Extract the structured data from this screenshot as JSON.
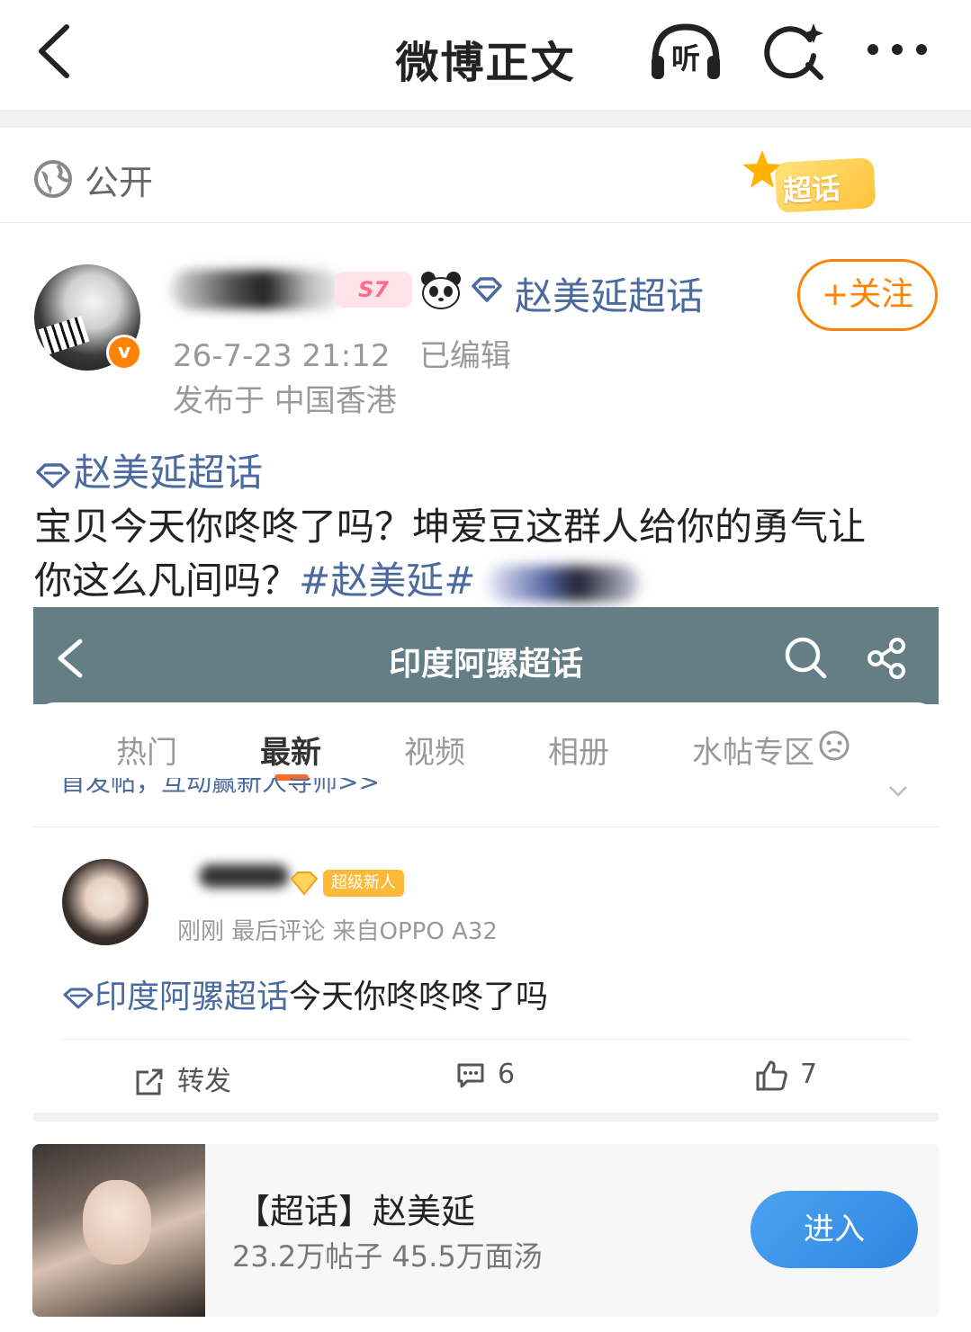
{
  "header": {
    "title": "微博正文",
    "listen_label": "听"
  },
  "visibility": {
    "label": "公开",
    "badge_label": "超话"
  },
  "post": {
    "author_level_badge": "S7",
    "author_topic": "赵美延超话",
    "follow_label": "+关注",
    "verified_badge": "v",
    "timestamp": "26-7-23 21:12",
    "edited_label": "已编辑",
    "location": "发布于 中国香港",
    "topic_link": "赵美延超话",
    "text_line1": "宝贝今天你咚咚了吗？坤爱豆这群人给你的勇气让",
    "text_line2_prefix": "你这么凡间吗？",
    "hashtag": "#赵美延#"
  },
  "embedded": {
    "title": "印度阿骡超话",
    "tabs": [
      "热门",
      "最新",
      "视频",
      "相册",
      "水帖专区"
    ],
    "active_tab": "最新",
    "partial_line": "首发帖，互动赢新人导师>>",
    "user_badge": "超级新人",
    "meta": "刚刚  最后评论   来自OPPO A32",
    "topic": "印度阿骡超话",
    "text": "今天你咚咚咚了吗",
    "actions": {
      "repost_label": "转发",
      "comment_count": "6",
      "like_count": "7"
    }
  },
  "topic_card": {
    "title": "【超话】赵美延",
    "stats": "23.2万帖子 45.5万面汤",
    "enter_label": "进入"
  }
}
